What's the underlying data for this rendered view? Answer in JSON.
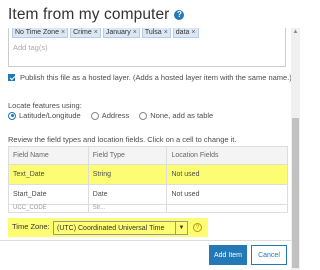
{
  "dialog": {
    "title": "Item from my computer",
    "help_icon": "?"
  },
  "tags": {
    "items": [
      {
        "label": "No Time Zone"
      },
      {
        "label": "Crime"
      },
      {
        "label": "January"
      },
      {
        "label": "Tulsa"
      },
      {
        "label": "data"
      }
    ],
    "remove_glyph": "×",
    "placeholder": "Add tag(s)"
  },
  "publish": {
    "checked": true,
    "text": "Publish this file as a hosted layer. (Adds a hosted layer item with the same name.)"
  },
  "locate": {
    "label": "Locate features using:",
    "options": [
      {
        "label": "Latitude/Longitude",
        "selected": true
      },
      {
        "label": "Address",
        "selected": false
      },
      {
        "label": "None, add as table",
        "selected": false
      }
    ]
  },
  "review": {
    "text": "Review the field types and location fields. Click on a cell to change it."
  },
  "table": {
    "headers": [
      "Field Name",
      "Field Type",
      "Location Fields"
    ],
    "rows": [
      {
        "name": "Text_Date",
        "type": "String",
        "location": "Not used",
        "highlighted": true
      },
      {
        "name": "Start_Date",
        "type": "Date",
        "location": "Not used",
        "highlighted": false
      },
      {
        "name": "UCC_CODE",
        "type": "Str...",
        "location": "",
        "highlighted": false
      }
    ]
  },
  "timezone": {
    "label": "Time Zone:",
    "value": "(UTC) Coordinated Universal Time",
    "arrow": "▼",
    "help": "?"
  },
  "buttons": {
    "add": "Add Item",
    "cancel": "Cancel"
  },
  "colors": {
    "accent": "#2379b6",
    "highlight": "#fdfd74"
  }
}
